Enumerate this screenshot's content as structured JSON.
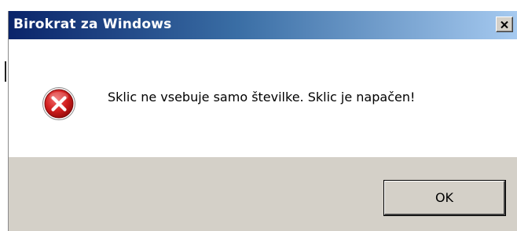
{
  "window": {
    "title": "Birokrat za Windows",
    "close_icon": "close-icon"
  },
  "message": {
    "icon": "error-icon",
    "text": "Sklic ne vsebuje samo številke. Sklic je napačen!"
  },
  "buttons": {
    "ok_label": "OK"
  },
  "colors": {
    "title_gradient_start": "#0a246a",
    "title_gradient_end": "#a6caf0",
    "footer_bg": "#d4d0c8",
    "error_red": "#c8102e"
  }
}
